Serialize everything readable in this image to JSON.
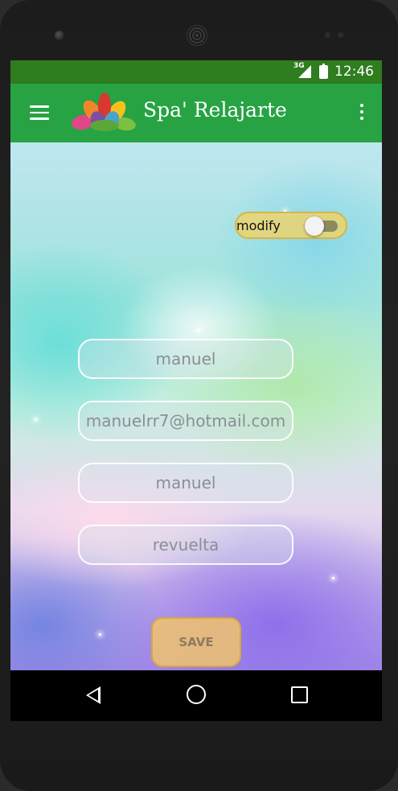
{
  "status_bar": {
    "network": "3G",
    "time": "12:46"
  },
  "app_bar": {
    "title": "Spa' Relajarte",
    "menu_icon": "hamburger-menu-icon",
    "overflow_icon": "more-vert-icon",
    "color": "#27a344"
  },
  "toggle": {
    "label": "modify",
    "state": "off"
  },
  "form": {
    "fields": [
      {
        "value": "manuel"
      },
      {
        "value": "manuelrr7@hotmail.com"
      },
      {
        "value": "manuel"
      },
      {
        "value": "revuelta"
      }
    ],
    "save_label": "SAVE"
  },
  "nav_bar": {
    "back_icon": "back-triangle-icon",
    "home_icon": "home-circle-icon",
    "recents_icon": "recents-square-icon"
  }
}
